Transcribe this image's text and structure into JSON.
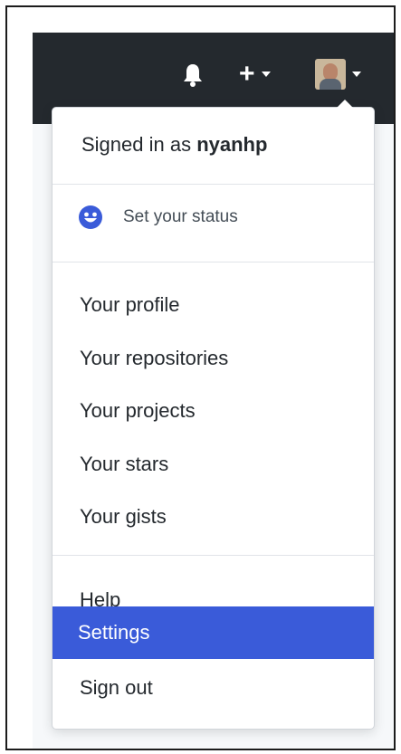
{
  "header": {
    "bell_icon": "bell-icon",
    "create_icon": "plus-icon",
    "avatar_icon": "avatar"
  },
  "menu": {
    "signed_in_prefix": "Signed in as ",
    "username": "nyanhp",
    "status_label": "Set your status",
    "status_icon": "smiley-icon",
    "items": [
      {
        "label": "Your profile"
      },
      {
        "label": "Your repositories"
      },
      {
        "label": "Your projects"
      },
      {
        "label": "Your stars"
      },
      {
        "label": "Your gists"
      },
      {
        "label": "Help"
      },
      {
        "label": "Settings",
        "active": true
      },
      {
        "label": "Sign out"
      }
    ]
  },
  "colors": {
    "header_bg": "#24292e",
    "active_bg": "#3a5bd9",
    "icon_blue": "#3a5bd9"
  }
}
